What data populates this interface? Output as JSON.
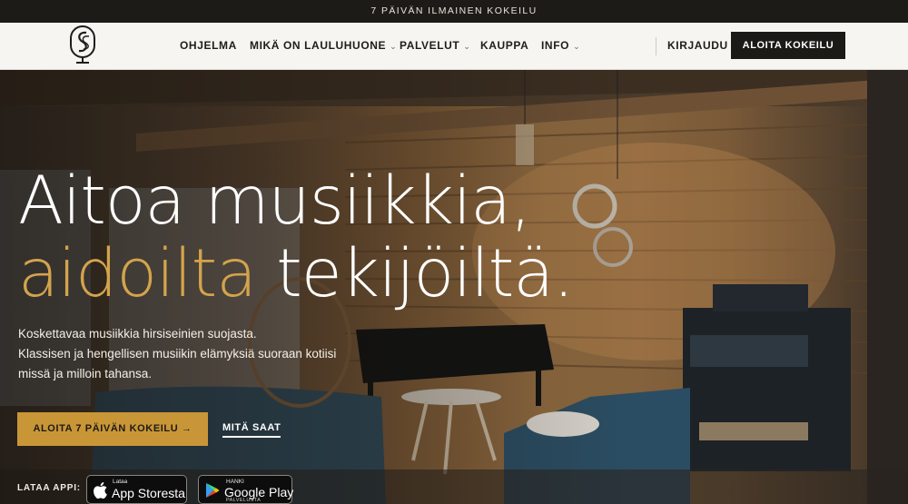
{
  "promo": {
    "text": "7 PÄIVÄN ILMAINEN KOKEILU"
  },
  "nav": {
    "items": [
      {
        "label": "OHJELMA"
      },
      {
        "label": "MIKÄ ON LAULUHUONE"
      },
      {
        "label": "PALVELUT"
      },
      {
        "label": "KAUPPA"
      },
      {
        "label": "INFO"
      }
    ],
    "chevron": "⌄",
    "login": "KIRJAUDU",
    "trial_button": "ALOITA KOKEILU"
  },
  "hero": {
    "headline_line1": "Aitoa musiikkia,",
    "headline_accent": "aidoilta",
    "headline_rest": " tekijöiltä.",
    "description": [
      "Koskettavaa musiikkia hirsiseinien suojasta.",
      "Klassisen ja hengellisen musiikin elämyksiä suoraan kotiisi",
      "missä ja milloin tahansa."
    ],
    "cta_primary": "ALOITA 7 PÄIVÄN KOKEILU →",
    "cta_secondary": "MITÄ SAAT",
    "download_label": "LATAA APPI:",
    "app_store": {
      "small": "Lataa",
      "big": "App Storesta"
    },
    "google_play": {
      "small": "HANKI",
      "big": "Google Play",
      "tiny": "PALVELUSTA"
    }
  },
  "colors": {
    "accent": "#c99637",
    "headline_accent": "#d4a34c",
    "dark": "#1c1a17",
    "nav_bg": "#f6f5f2"
  },
  "icons": [
    "logo-icon",
    "chevron-down-icon",
    "apple-icon",
    "google-play-icon"
  ]
}
